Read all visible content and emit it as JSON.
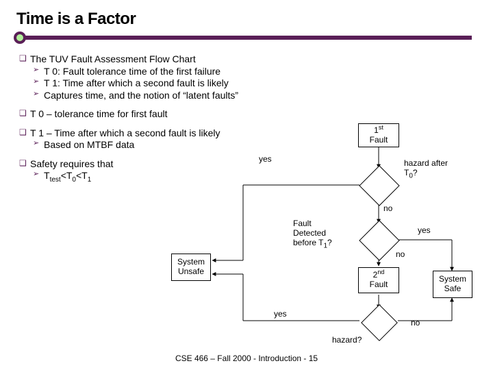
{
  "title": "Time is a Factor",
  "bullets": {
    "b1": "The TUV Fault Assessment Flow Chart",
    "b1a": "T 0: Fault tolerance time of the first failure",
    "b1b": "T 1: Time after which a second fault is likely",
    "b1c": "Captures time, and the notion of “latent faults”",
    "b2": "T 0 – tolerance time for first fault",
    "b3": "T 1 – Time after which a second fault is likely",
    "b3a": "Based on MTBF data",
    "b4": "Safety requires that",
    "b4a_html": "T"
  },
  "safety_line": {
    "t_test": "T",
    "test_sub": "test",
    "lt1": "<T",
    "zero": "0",
    "lt2": "<T",
    "one": "1"
  },
  "diagram": {
    "first_fault_line1": "1",
    "first_fault_sup": "st",
    "first_fault_line2": "Fault",
    "hazard_t0_line1": "hazard after",
    "hazard_t0_line2a": "T",
    "hazard_t0_sub": "0",
    "hazard_t0_line2b": "?",
    "fault_detected_line1": "Fault",
    "fault_detected_line2": "Detected",
    "fault_detected_line3a": "before T",
    "fault_detected_sub": "1",
    "fault_detected_line3b": "?",
    "second_fault_line1": "2",
    "second_fault_sup": "nd",
    "second_fault_line2": "Fault",
    "hazard_q": "hazard?",
    "system_unsafe_l1": "System",
    "system_unsafe_l2": "Unsafe",
    "system_safe_l1": "System",
    "system_safe_l2": "Safe",
    "yes": "yes",
    "no": "no"
  },
  "footer": "CSE 466 – Fall 2000 - Introduction - 15"
}
